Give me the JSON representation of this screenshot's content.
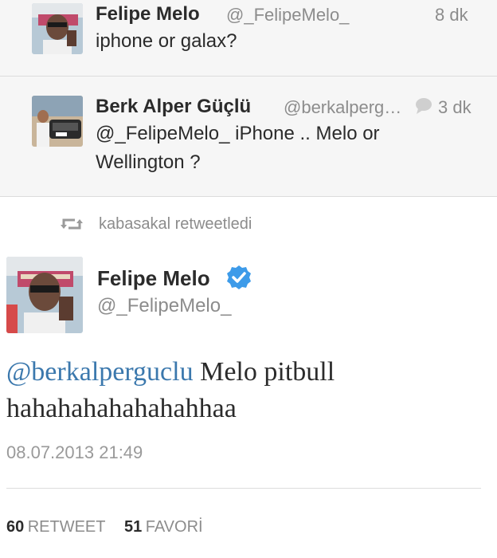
{
  "tweet1": {
    "name": "Felipe Melo",
    "handle": "@_FelipeMelo_",
    "time": "8 dk",
    "text": "iphone or galax?"
  },
  "tweet2": {
    "name": "Berk Alper Güçlü",
    "handle": "@berkalperg…",
    "time": "3 dk",
    "text_line1": "@_FelipeMelo_ iPhone .. Melo or",
    "text_line2": "Wellington ?"
  },
  "retweet_line": {
    "text": "kabasakal retweetledi"
  },
  "main": {
    "name": "Felipe Melo",
    "handle": "@_FelipeMelo_",
    "mention": "@berkalperguclu",
    "text_rest": " Melo pitbull",
    "text_line2": "hahahahahahahahhaa",
    "datetime": "08.07.2013 21:49"
  },
  "stats": {
    "retweet_count": "60",
    "retweet_label": "RETWEET",
    "fav_count": "51",
    "fav_label": "FAVORİ"
  },
  "colors": {
    "link": "#3b78ad",
    "verified": "#3d9be9",
    "muted": "#8c8c8c"
  }
}
